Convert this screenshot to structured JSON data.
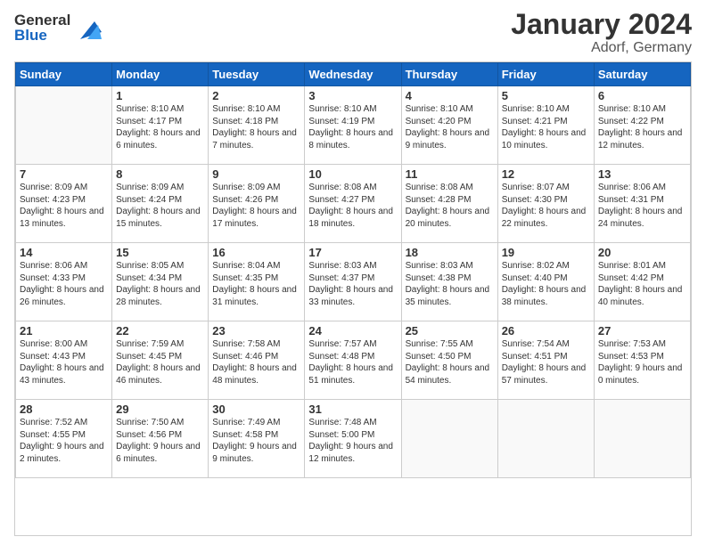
{
  "header": {
    "logo_general": "General",
    "logo_blue": "Blue",
    "month": "January 2024",
    "location": "Adorf, Germany"
  },
  "weekdays": [
    "Sunday",
    "Monday",
    "Tuesday",
    "Wednesday",
    "Thursday",
    "Friday",
    "Saturday"
  ],
  "weeks": [
    [
      {
        "day": "",
        "empty": true
      },
      {
        "day": "1",
        "sunrise": "8:10 AM",
        "sunset": "4:17 PM",
        "daylight": "8 hours and 6 minutes."
      },
      {
        "day": "2",
        "sunrise": "8:10 AM",
        "sunset": "4:18 PM",
        "daylight": "8 hours and 7 minutes."
      },
      {
        "day": "3",
        "sunrise": "8:10 AM",
        "sunset": "4:19 PM",
        "daylight": "8 hours and 8 minutes."
      },
      {
        "day": "4",
        "sunrise": "8:10 AM",
        "sunset": "4:20 PM",
        "daylight": "8 hours and 9 minutes."
      },
      {
        "day": "5",
        "sunrise": "8:10 AM",
        "sunset": "4:21 PM",
        "daylight": "8 hours and 10 minutes."
      },
      {
        "day": "6",
        "sunrise": "8:10 AM",
        "sunset": "4:22 PM",
        "daylight": "8 hours and 12 minutes."
      }
    ],
    [
      {
        "day": "7",
        "sunrise": "8:09 AM",
        "sunset": "4:23 PM",
        "daylight": "8 hours and 13 minutes."
      },
      {
        "day": "8",
        "sunrise": "8:09 AM",
        "sunset": "4:24 PM",
        "daylight": "8 hours and 15 minutes."
      },
      {
        "day": "9",
        "sunrise": "8:09 AM",
        "sunset": "4:26 PM",
        "daylight": "8 hours and 17 minutes."
      },
      {
        "day": "10",
        "sunrise": "8:08 AM",
        "sunset": "4:27 PM",
        "daylight": "8 hours and 18 minutes."
      },
      {
        "day": "11",
        "sunrise": "8:08 AM",
        "sunset": "4:28 PM",
        "daylight": "8 hours and 20 minutes."
      },
      {
        "day": "12",
        "sunrise": "8:07 AM",
        "sunset": "4:30 PM",
        "daylight": "8 hours and 22 minutes."
      },
      {
        "day": "13",
        "sunrise": "8:06 AM",
        "sunset": "4:31 PM",
        "daylight": "8 hours and 24 minutes."
      }
    ],
    [
      {
        "day": "14",
        "sunrise": "8:06 AM",
        "sunset": "4:33 PM",
        "daylight": "8 hours and 26 minutes."
      },
      {
        "day": "15",
        "sunrise": "8:05 AM",
        "sunset": "4:34 PM",
        "daylight": "8 hours and 28 minutes."
      },
      {
        "day": "16",
        "sunrise": "8:04 AM",
        "sunset": "4:35 PM",
        "daylight": "8 hours and 31 minutes."
      },
      {
        "day": "17",
        "sunrise": "8:03 AM",
        "sunset": "4:37 PM",
        "daylight": "8 hours and 33 minutes."
      },
      {
        "day": "18",
        "sunrise": "8:03 AM",
        "sunset": "4:38 PM",
        "daylight": "8 hours and 35 minutes."
      },
      {
        "day": "19",
        "sunrise": "8:02 AM",
        "sunset": "4:40 PM",
        "daylight": "8 hours and 38 minutes."
      },
      {
        "day": "20",
        "sunrise": "8:01 AM",
        "sunset": "4:42 PM",
        "daylight": "8 hours and 40 minutes."
      }
    ],
    [
      {
        "day": "21",
        "sunrise": "8:00 AM",
        "sunset": "4:43 PM",
        "daylight": "8 hours and 43 minutes."
      },
      {
        "day": "22",
        "sunrise": "7:59 AM",
        "sunset": "4:45 PM",
        "daylight": "8 hours and 46 minutes."
      },
      {
        "day": "23",
        "sunrise": "7:58 AM",
        "sunset": "4:46 PM",
        "daylight": "8 hours and 48 minutes."
      },
      {
        "day": "24",
        "sunrise": "7:57 AM",
        "sunset": "4:48 PM",
        "daylight": "8 hours and 51 minutes."
      },
      {
        "day": "25",
        "sunrise": "7:55 AM",
        "sunset": "4:50 PM",
        "daylight": "8 hours and 54 minutes."
      },
      {
        "day": "26",
        "sunrise": "7:54 AM",
        "sunset": "4:51 PM",
        "daylight": "8 hours and 57 minutes."
      },
      {
        "day": "27",
        "sunrise": "7:53 AM",
        "sunset": "4:53 PM",
        "daylight": "9 hours and 0 minutes."
      }
    ],
    [
      {
        "day": "28",
        "sunrise": "7:52 AM",
        "sunset": "4:55 PM",
        "daylight": "9 hours and 2 minutes."
      },
      {
        "day": "29",
        "sunrise": "7:50 AM",
        "sunset": "4:56 PM",
        "daylight": "9 hours and 6 minutes."
      },
      {
        "day": "30",
        "sunrise": "7:49 AM",
        "sunset": "4:58 PM",
        "daylight": "9 hours and 9 minutes."
      },
      {
        "day": "31",
        "sunrise": "7:48 AM",
        "sunset": "5:00 PM",
        "daylight": "9 hours and 12 minutes."
      },
      {
        "day": "",
        "empty": true
      },
      {
        "day": "",
        "empty": true
      },
      {
        "day": "",
        "empty": true
      }
    ]
  ]
}
